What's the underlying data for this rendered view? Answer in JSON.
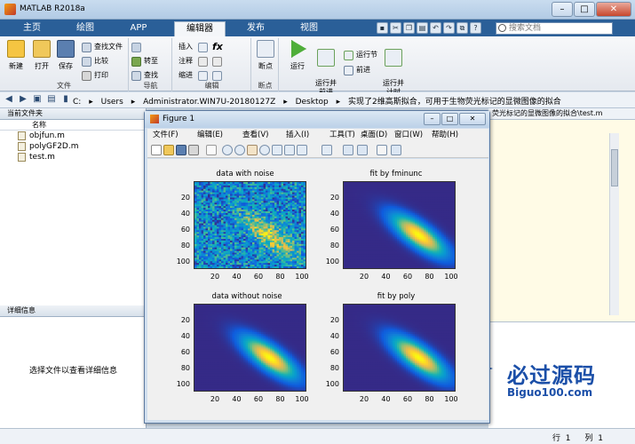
{
  "window": {
    "title": "MATLAB R2018a"
  },
  "ribbon": {
    "tabs": [
      {
        "label": "主页",
        "active": false
      },
      {
        "label": "绘图",
        "active": false
      },
      {
        "label": "APP",
        "active": false
      },
      {
        "label": "编辑器",
        "active": true
      },
      {
        "label": "发布",
        "active": false
      },
      {
        "label": "视图",
        "active": false
      }
    ],
    "search_placeholder": "搜索文档"
  },
  "toolstrip": {
    "file": {
      "label": "文件",
      "new": "新建",
      "open": "打开",
      "save": "保存",
      "find_files": "查找文件",
      "compare": "比较",
      "print": "打印"
    },
    "navigate": {
      "label": "导航",
      "goto": "转至",
      "find": "查找"
    },
    "edit": {
      "label": "编辑",
      "insert": "插入",
      "comment": "注释",
      "indent": "缩进"
    },
    "breakpoints": {
      "label": "断点",
      "breakpoint": "断点"
    },
    "run": {
      "run": "运行",
      "run_advance": "运行并\n前进",
      "run_section": "运行节",
      "advance": "前进",
      "run_time": "运行并\n计时"
    }
  },
  "address_bar": {
    "segments": [
      "C:",
      "Users",
      "Administrator.WIN7U-20180127Z",
      "Desktop",
      "实现了2维高斯拟合，可用于生物荧光标记的显微图像的拟合"
    ]
  },
  "current_folder": {
    "title": "当前文件夹",
    "name_header": "名称",
    "files": [
      "objfun.m",
      "polyGF2D.m",
      "test.m"
    ]
  },
  "details": {
    "title": "详细信息",
    "message": "选择文件以查看详细信息"
  },
  "editor": {
    "tab_text": "荧光标记的显微图像的拟合\\test.m"
  },
  "status": {
    "row_label": "行",
    "row_value": "1",
    "col_label": "列",
    "col_value": "1"
  },
  "watermark": {
    "title": "必过源码",
    "subtitle": "Biguo100.com"
  },
  "figure": {
    "title": "Figure 1",
    "menus": [
      "文件(F)",
      "编辑(E)",
      "查看(V)",
      "插入(I)",
      "工具(T)",
      "桌面(D)",
      "窗口(W)",
      "帮助(H)"
    ],
    "subplots": [
      {
        "title": "data with noise",
        "noisy": true
      },
      {
        "title": "fit by fminunc",
        "noisy": false
      },
      {
        "title": "data without noise",
        "noisy": false
      },
      {
        "title": "fit by poly",
        "noisy": false
      }
    ],
    "yticks": [
      "20",
      "40",
      "60",
      "80",
      "100"
    ],
    "xticks": [
      "20",
      "40",
      "60",
      "80",
      "100"
    ]
  },
  "colors": {
    "ribbon_blue": "#2a5f98",
    "parula_low": "#352a87",
    "parula_high": "#f9fb0e"
  }
}
